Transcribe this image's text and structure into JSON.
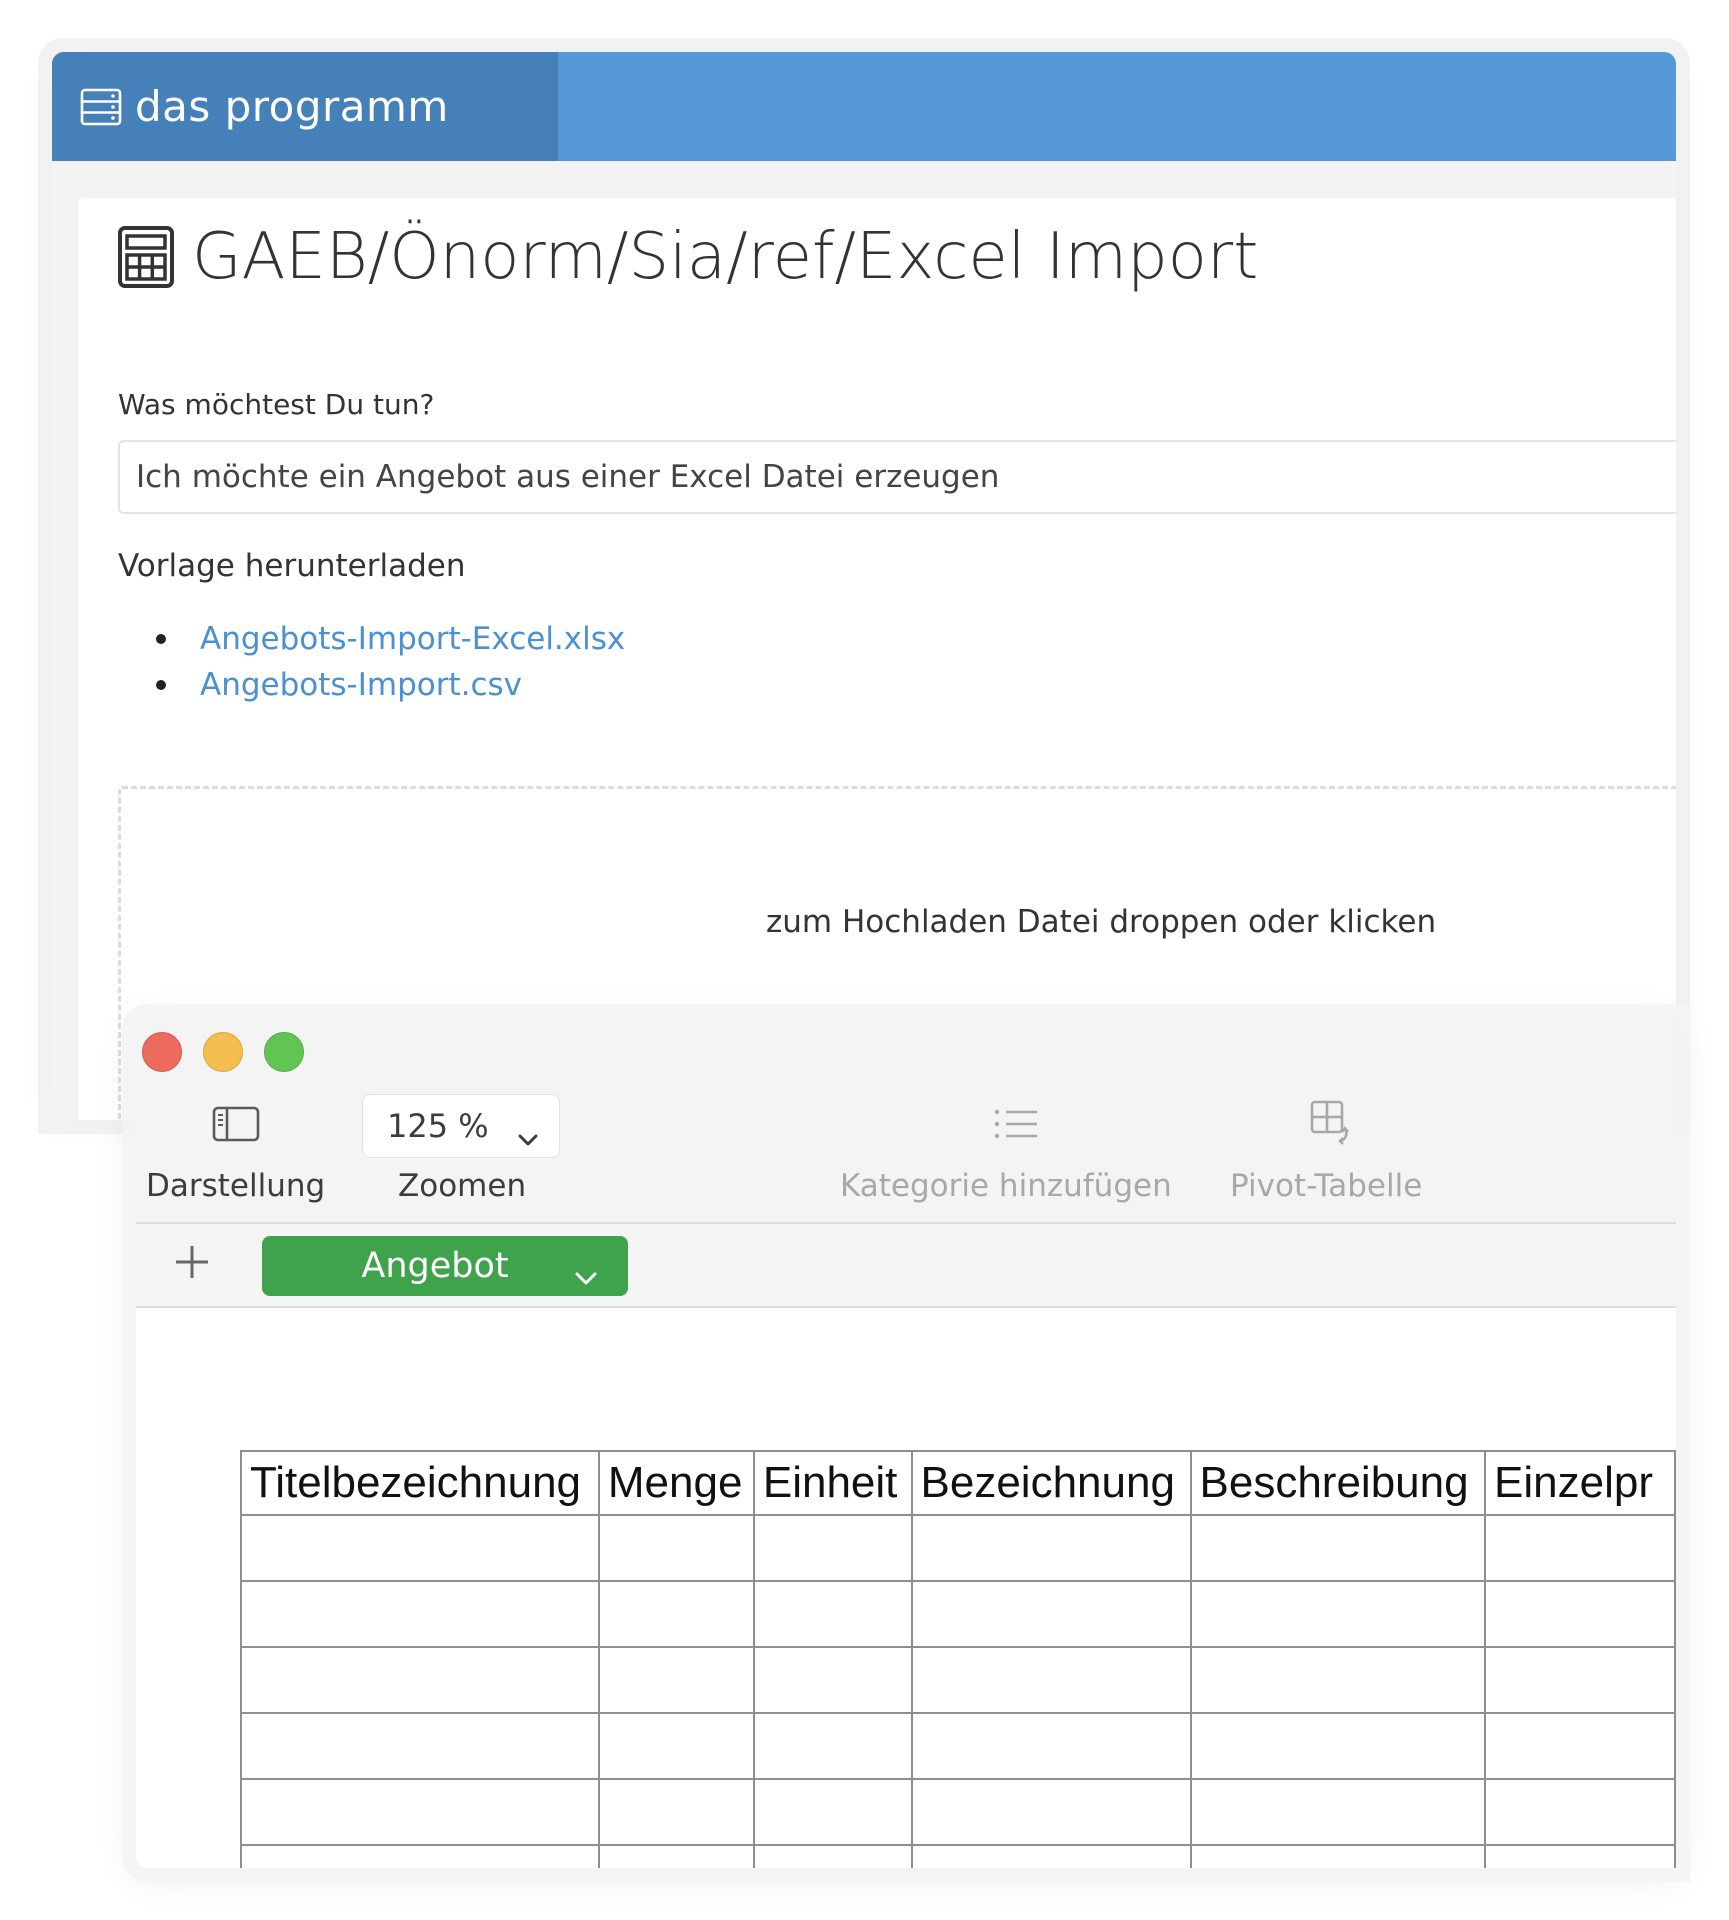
{
  "app": {
    "brand_title": "das programm",
    "brand_icon": "server-icon",
    "header_color": "#5499d6",
    "brand_color": "#4580b9"
  },
  "page": {
    "title": "GAEB/Önorm/Sia/ref/Excel Import",
    "title_icon": "calculator-icon",
    "question_label": "Was möchtest Du tun?",
    "action_select_value": "Ich möchte ein Angebot aus einer Excel Datei erzeugen",
    "template_label": "Vorlage herunterladen",
    "templates": [
      {
        "label": "Angebots-Import-Excel.xlsx"
      },
      {
        "label": "Angebots-Import.csv"
      }
    ],
    "link_color": "#4a90d2",
    "dropzone_text": "zum Hochladen Datei droppen oder klicken"
  },
  "spreadsheet": {
    "toolbar": {
      "view_label": "Darstellung",
      "view_icon": "sidebar-icon",
      "zoom_value": "125 %",
      "zoom_label": "Zoomen",
      "category_label": "Kategorie hinzufügen",
      "category_icon": "list-icon",
      "pivot_label": "Pivot-Tabelle",
      "pivot_icon": "pivot-table-icon"
    },
    "sheet_tab": {
      "label": "Angebot",
      "color": "#3ea34a"
    },
    "columns": [
      "Titelbezeichnung",
      "Menge",
      "Einheit",
      "Bezeichnung",
      "Beschreibung",
      "Einzelpr"
    ],
    "empty_row_count_visible": 6
  }
}
